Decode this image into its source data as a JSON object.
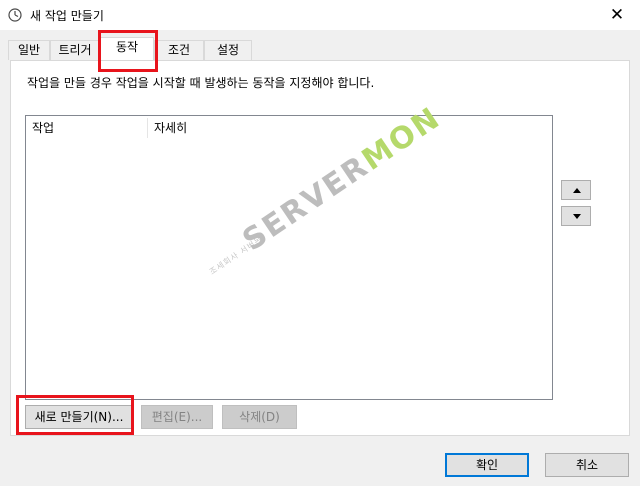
{
  "window": {
    "title": "새 작업 만들기",
    "close_glyph": "✕",
    "icon": "clock-icon"
  },
  "tabs": [
    {
      "label": "일반",
      "active": false
    },
    {
      "label": "트리거",
      "active": false
    },
    {
      "label": "동작",
      "active": true
    },
    {
      "label": "조건",
      "active": false
    },
    {
      "label": "설정",
      "active": false
    }
  ],
  "actions_page": {
    "instruction": "작업을 만들 경우 작업을 시작할 때 발생하는 동작을 지정해야 합니다.",
    "columns": [
      "작업",
      "자세히"
    ],
    "rows": []
  },
  "buttons": {
    "new": "새로 만들기(N)...",
    "edit": "편집(E)...",
    "delete": "삭제(D)",
    "ok": "확인",
    "cancel": "취소",
    "move_up_icon": "triangle-up-icon",
    "move_down_icon": "triangle-down-icon"
  },
  "watermark": {
    "small": "조세회사 서버몬",
    "part1": "SERVER",
    "part2": "MON"
  },
  "colors": {
    "highlight": "#e8141c",
    "watermark_green": "#b5d96b",
    "focus_blue": "#0078d7"
  }
}
